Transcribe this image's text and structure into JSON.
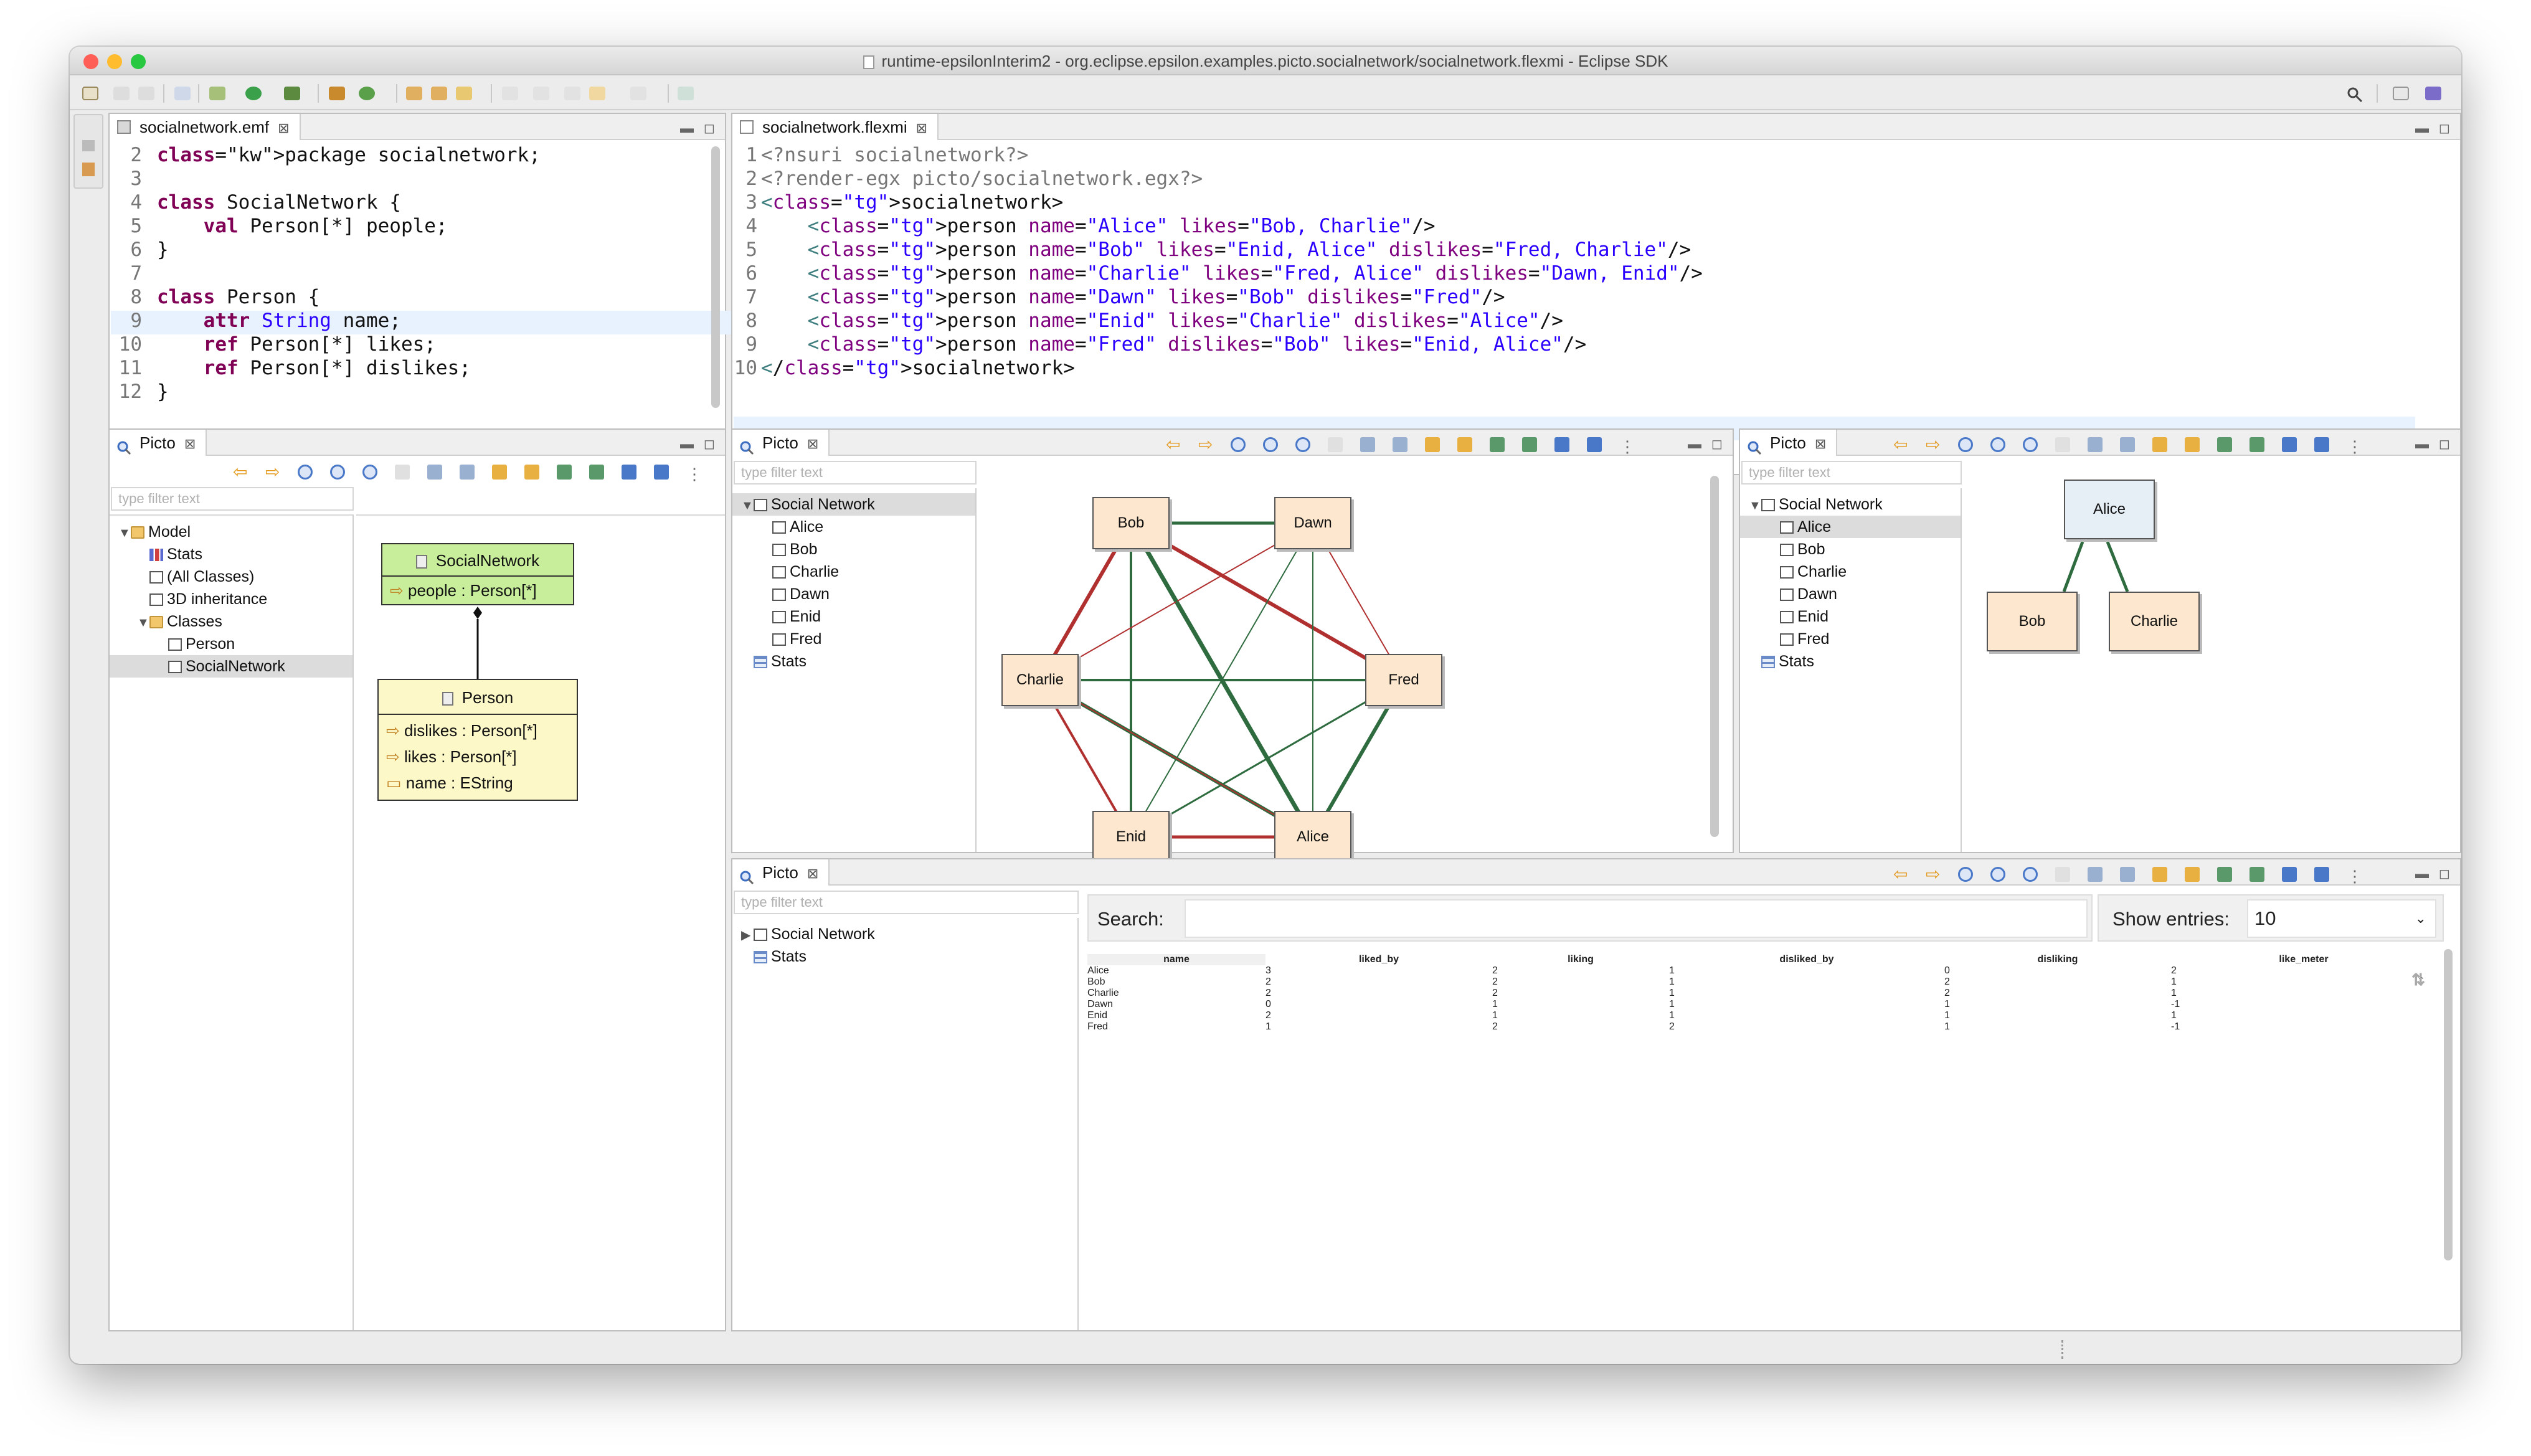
{
  "window": {
    "title": "runtime-epsilonInterim2 - org.eclipse.epsilon.examples.picto.socialnetwork/socialnetwork.flexmi - Eclipse SDK"
  },
  "editors": {
    "emf": {
      "tab": "socialnetwork.emf",
      "lines": [
        {
          "n": "2",
          "t": "package socialnetwork;"
        },
        {
          "n": "3",
          "t": ""
        },
        {
          "n": "4",
          "t": "class SocialNetwork {"
        },
        {
          "n": "5",
          "t": "    val Person[*] people;"
        },
        {
          "n": "6",
          "t": "}"
        },
        {
          "n": "7",
          "t": ""
        },
        {
          "n": "8",
          "t": "class Person {"
        },
        {
          "n": "9",
          "t": "    attr String name;"
        },
        {
          "n": "10",
          "t": "    ref Person[*] likes;"
        },
        {
          "n": "11",
          "t": "    ref Person[*] dislikes;"
        },
        {
          "n": "12",
          "t": "}"
        }
      ]
    },
    "flexmi": {
      "tab": "socialnetwork.flexmi",
      "lines": [
        {
          "n": "1",
          "t": "<?nsuri socialnetwork?>"
        },
        {
          "n": "2",
          "t": "<?render-egx picto/socialnetwork.egx?>"
        },
        {
          "n": "3",
          "t": "<socialnetwork>"
        },
        {
          "n": "4",
          "t": "    <person name=\"Alice\" likes=\"Bob, Charlie\"/>"
        },
        {
          "n": "5",
          "t": "    <person name=\"Bob\" likes=\"Enid, Alice\" dislikes=\"Fred, Charlie\"/>"
        },
        {
          "n": "6",
          "t": "    <person name=\"Charlie\" likes=\"Fred, Alice\" dislikes=\"Dawn, Enid\"/>"
        },
        {
          "n": "7",
          "t": "    <person name=\"Dawn\" likes=\"Bob\" dislikes=\"Fred\"/>"
        },
        {
          "n": "8",
          "t": "    <person name=\"Enid\" likes=\"Charlie\" dislikes=\"Alice\"/>"
        },
        {
          "n": "9",
          "t": "    <person name=\"Fred\" dislikes=\"Bob\" likes=\"Enid, Alice\"/>"
        },
        {
          "n": "10",
          "t": "</socialnetwork>"
        }
      ]
    }
  },
  "picto1": {
    "tab": "Picto",
    "filter_placeholder": "type filter text",
    "tree": [
      "Model",
      "Stats",
      "(All Classes)",
      "3D inheritance",
      "Classes",
      "Person",
      "SocialNetwork"
    ],
    "classes": {
      "social_network": {
        "name": "SocialNetwork",
        "attrs": [
          "people : Person[*]"
        ]
      },
      "person": {
        "name": "Person",
        "attrs": [
          "dislikes : Person[*]",
          "likes : Person[*]",
          "name : EString"
        ]
      }
    }
  },
  "picto2": {
    "tab": "Picto",
    "filter_placeholder": "type filter text",
    "tree": [
      "Social Network",
      "Alice",
      "Bob",
      "Charlie",
      "Dawn",
      "Enid",
      "Fred",
      "Stats"
    ],
    "nodes": [
      "Bob",
      "Dawn",
      "Charlie",
      "Fred",
      "Enid",
      "Alice"
    ],
    "colors": {
      "likes": "#2e6b3f",
      "dislikes": "#b03030"
    }
  },
  "picto3": {
    "tab": "Picto",
    "filter_placeholder": "type filter text",
    "tree": [
      "Social Network",
      "Alice",
      "Bob",
      "Charlie",
      "Dawn",
      "Enid",
      "Fred",
      "Stats"
    ],
    "nodes": [
      "Alice",
      "Bob",
      "Charlie"
    ]
  },
  "picto4": {
    "tab": "Picto",
    "filter_placeholder": "type filter text",
    "tree": [
      "Social Network",
      "Stats"
    ],
    "search_label": "Search:",
    "search_value": "",
    "show_entries_label": "Show entries:",
    "show_entries_value": "10",
    "sort_active": "↑",
    "sort_idle": "⇅",
    "columns": [
      "name",
      "liked_by",
      "liking",
      "disliked_by",
      "disliking",
      "like_meter"
    ],
    "rows": [
      [
        "Alice",
        "3",
        "2",
        "1",
        "0",
        "2"
      ],
      [
        "Bob",
        "2",
        "2",
        "1",
        "2",
        "1"
      ],
      [
        "Charlie",
        "2",
        "2",
        "1",
        "2",
        "1"
      ],
      [
        "Dawn",
        "0",
        "1",
        "1",
        "1",
        "-1"
      ],
      [
        "Enid",
        "2",
        "1",
        "1",
        "1",
        "1"
      ],
      [
        "Fred",
        "1",
        "2",
        "2",
        "1",
        "-1"
      ]
    ]
  }
}
